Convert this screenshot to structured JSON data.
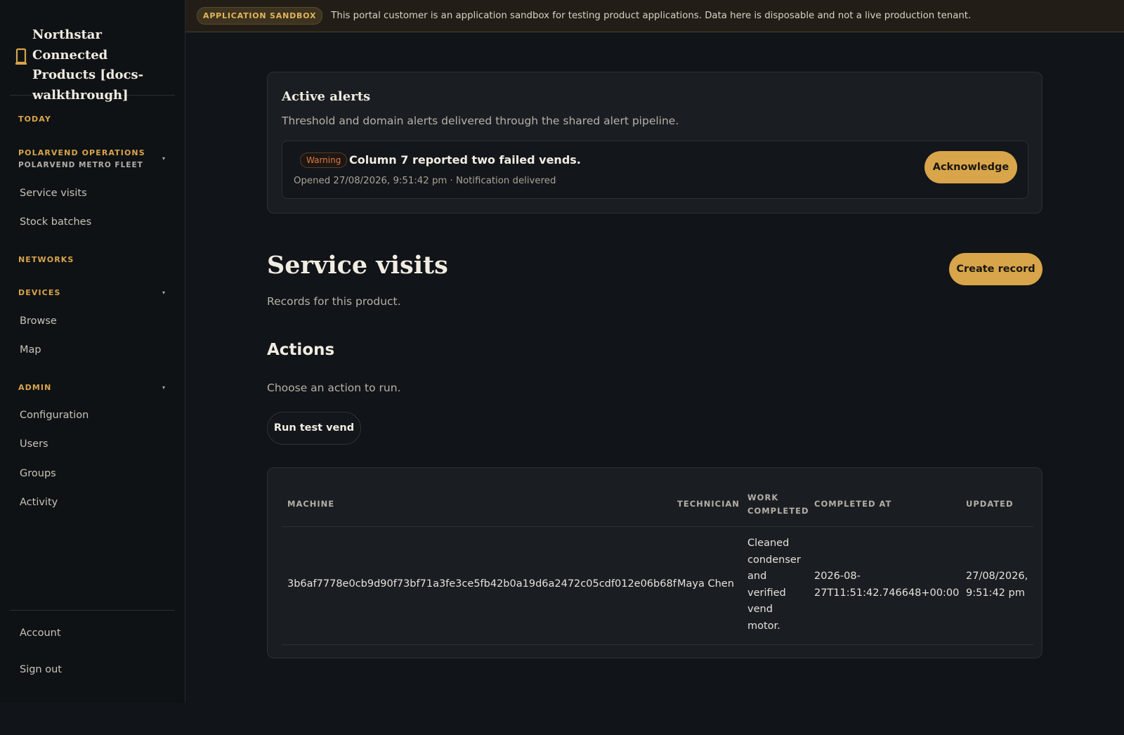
{
  "brand": {
    "title": "Northstar Connected Products [docs-walkthrough]"
  },
  "banner": {
    "badge": "APPLICATION SANDBOX",
    "text": "This portal customer is an application sandbox for testing product applications. Data here is disposable and not a live production tenant."
  },
  "sidebar": {
    "today": "TODAY",
    "polarvend": "POLARVEND OPERATIONS",
    "polarvend_sub": "POLARVEND METRO FLEET",
    "service_visits": "Service visits",
    "stock_batches": "Stock batches",
    "networks": "NETWORKS",
    "devices": "DEVICES",
    "browse": "Browse",
    "map": "Map",
    "admin": "ADMIN",
    "configuration": "Configuration",
    "users": "Users",
    "groups": "Groups",
    "activity": "Activity",
    "account": "Account",
    "sign_out": "Sign out",
    "caret": "▾"
  },
  "alerts": {
    "title": "Active alerts",
    "description": "Threshold and domain alerts delivered through the shared alert pipeline.",
    "items": [
      {
        "severity": "Warning",
        "title": "Column 7 reported two failed vends.",
        "meta": "Opened 27/08/2026, 9:51:42 pm · Notification delivered",
        "action": "Acknowledge"
      }
    ]
  },
  "page": {
    "title": "Service visits",
    "description": "Records for this product.",
    "create_label": "Create record"
  },
  "actions": {
    "title": "Actions",
    "description": "Choose an action to run.",
    "run_label": "Run test vend"
  },
  "table": {
    "headers": {
      "machine": "MACHINE",
      "technician": "TECHNICIAN",
      "work_1": "WORK",
      "work_2": "COMPLETED",
      "completed_at": "COMPLETED AT",
      "updated": "UPDATED"
    },
    "rows": [
      {
        "machine": "3b6af7778e0cb9d90f73bf71a3fe3ce5fb42b0a19d6a2472c05cdf012e06b68f",
        "technician": "Maya Chen",
        "work_lines": [
          "Cleaned",
          "condenser",
          "and",
          "verified",
          "vend",
          "motor."
        ],
        "completed_lines": [
          "2026-08-",
          "27T11:51:42.746648+00:00"
        ],
        "updated_lines": [
          "27/08/2026,",
          "9:51:42 pm"
        ]
      }
    ]
  },
  "colors": {
    "accent": "#d8a54a",
    "warning": "#e0783c",
    "background": "#111418"
  }
}
